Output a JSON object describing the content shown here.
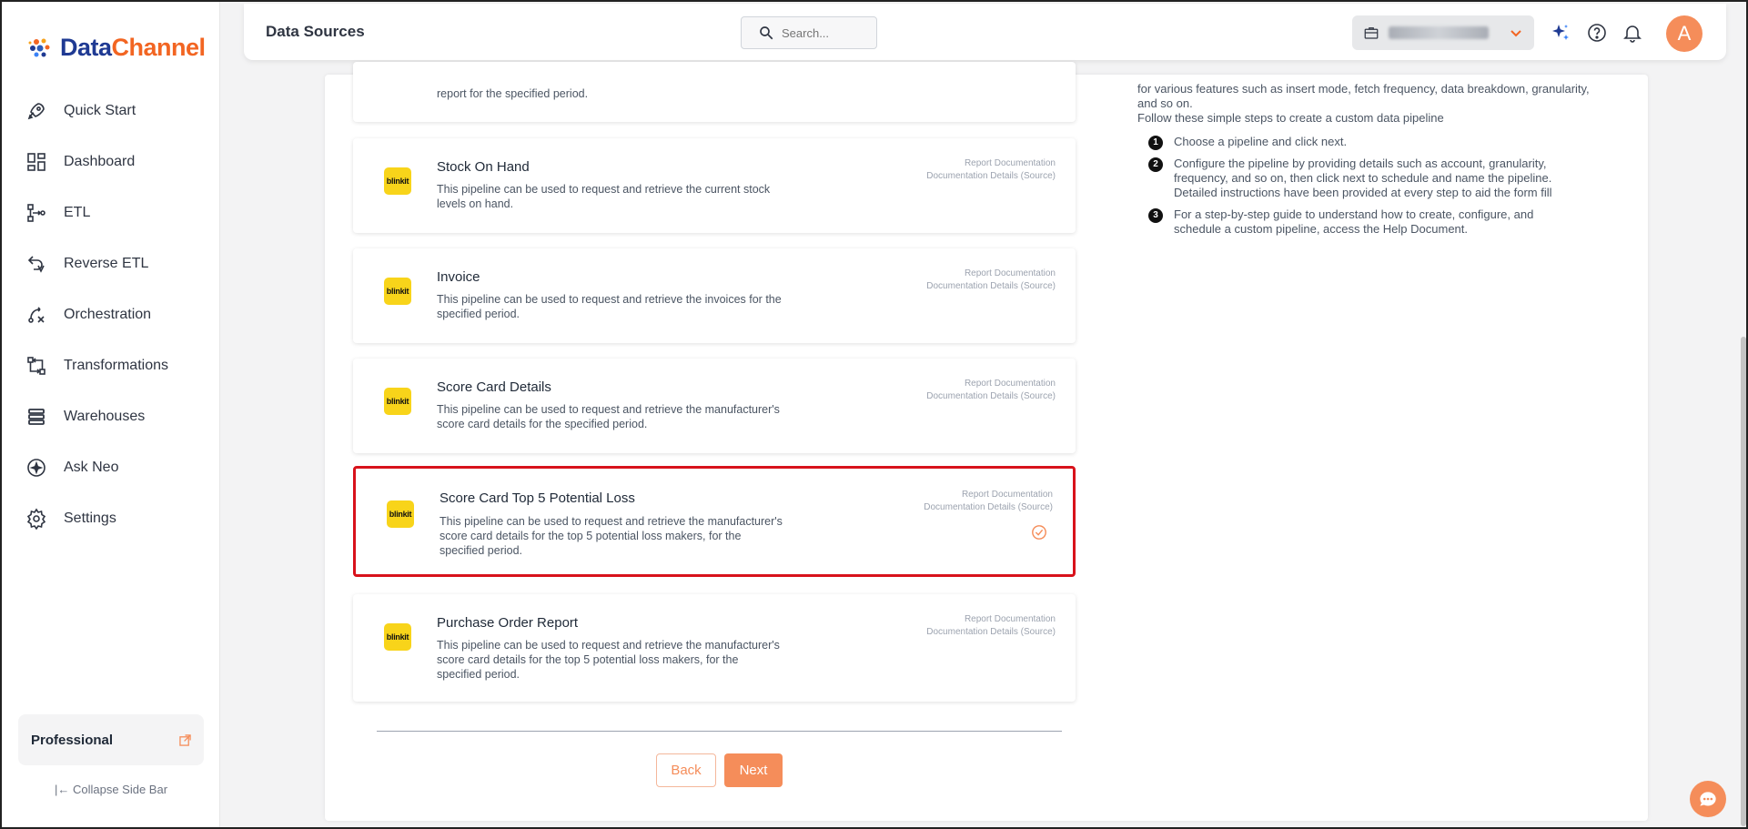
{
  "brand": {
    "name_part1": "Data",
    "name_part2": "Channel"
  },
  "sidebar": {
    "items": [
      {
        "label": "Quick Start",
        "icon": "rocket-icon"
      },
      {
        "label": "Dashboard",
        "icon": "dashboard-icon"
      },
      {
        "label": "ETL",
        "icon": "etl-icon"
      },
      {
        "label": "Reverse ETL",
        "icon": "reverse-etl-icon"
      },
      {
        "label": "Orchestration",
        "icon": "orchestration-icon"
      },
      {
        "label": "Transformations",
        "icon": "transformations-icon"
      },
      {
        "label": "Warehouses",
        "icon": "warehouses-icon"
      },
      {
        "label": "Ask Neo",
        "icon": "sparkle-icon"
      },
      {
        "label": "Settings",
        "icon": "gear-icon"
      }
    ],
    "plan": "Professional",
    "collapse_label": "Collapse Side Bar"
  },
  "header": {
    "title": "Data Sources",
    "search_placeholder": "Search...",
    "avatar_initial": "A"
  },
  "pipelines": [
    {
      "title": "",
      "desc": "report for the specified period.",
      "link1": "",
      "link2": ""
    },
    {
      "title": "Stock On Hand",
      "desc": "This pipeline can be used to request and retrieve the current stock levels on hand.",
      "link1": "Report Documentation",
      "link2": "Documentation Details (Source)"
    },
    {
      "title": "Invoice",
      "desc": "This pipeline can be used to request and retrieve the invoices for the specified period.",
      "link1": "Report Documentation",
      "link2": "Documentation Details (Source)"
    },
    {
      "title": "Score Card Details",
      "desc": "This pipeline can be used to request and retrieve the manufacturer's score card details for the specified period.",
      "link1": "Report Documentation",
      "link2": "Documentation Details (Source)"
    },
    {
      "title": "Score Card Top 5 Potential Loss",
      "desc": "This pipeline can be used to request and retrieve the manufacturer's score card details for the top 5 potential loss makers, for the specified period.",
      "link1": "Report Documentation",
      "link2": "Documentation Details (Source)"
    },
    {
      "title": "Purchase Order Report",
      "desc": "This pipeline can be used to request and retrieve the manufacturer's score card details for the top 5 potential loss makers, for the specified period.",
      "link1": "Report Documentation",
      "link2": "Documentation Details (Source)"
    }
  ],
  "badge_text": "blinkit",
  "info": {
    "intro1": "for various features such as insert mode, fetch frequency, data breakdown, granularity, and so on.",
    "intro2": "Follow these simple steps to create a custom data pipeline",
    "steps": [
      {
        "num": "1",
        "text": "Choose a pipeline and click next."
      },
      {
        "num": "2",
        "text": "Configure the pipeline by providing details such as account, granularity, frequency, and so on, then click next to schedule and name the pipeline. Detailed instructions have been provided at every step to aid the form fill"
      },
      {
        "num": "3",
        "text": "For a step-by-step guide to understand how to create, configure, and schedule a custom pipeline, access the Help Document."
      }
    ]
  },
  "buttons": {
    "back": "Back",
    "next": "Next"
  },
  "colors": {
    "accent": "#f58d5a",
    "selected_border": "#d8121b",
    "badge": "#f8d41a"
  }
}
